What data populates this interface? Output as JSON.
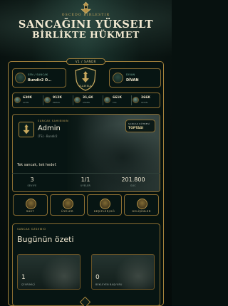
{
  "colors": {
    "gold": "#a8843c",
    "gold_text": "#c9a95e",
    "teal_label": "#7fb9a4",
    "background": "#07110f"
  },
  "header": {
    "subtitle": "OSCEDO BIRLESTIR",
    "title_line1": "SANCAĞINI YÜKSELT",
    "title_line2": "BİRLİKTE HÜKMET"
  },
  "top_bar": {
    "pill": "V1 / SANDR",
    "logo_text": "SAHBA",
    "sancak_label": "SEN / SANCAK",
    "sancak_value": "Bundir2 O…",
    "divan_label": "DIVAN",
    "divan_value": "DİVAN"
  },
  "stats": [
    {
      "value": "630K",
      "sub": "ALTIN",
      "icon": "coin-icon"
    },
    {
      "value": "912K",
      "sub": "ERZAK",
      "icon": "grain-icon"
    },
    {
      "value": "31,6K",
      "sub": "ASKER",
      "icon": "sword-icon"
    },
    {
      "value": "661K",
      "sub": "TAS",
      "icon": "stone-icon"
    },
    {
      "value": "266K",
      "sub": "ODUN",
      "icon": "wood-icon"
    }
  ],
  "profile": {
    "section_label": "SANCAK SAHIBININ",
    "name": "Admin",
    "subtitle": "(TS) · Bundir2",
    "tier_label": "SANCAK RÜTBESİ",
    "tier_value": "TOPTASI",
    "motto": "Tek sancak, tek hedef.",
    "stats": [
      {
        "value": "3",
        "label": "SEVIYE"
      },
      {
        "value": "1/1",
        "label": "UYELER"
      },
      {
        "value": "201.800",
        "label": "GUC"
      }
    ]
  },
  "actions": [
    {
      "label": "SAVT",
      "icon": "helmet-icon"
    },
    {
      "label": "ÜYELER",
      "icon": "members-icon"
    },
    {
      "label": "KEŞİFLER/GÖ",
      "icon": "compass-icon"
    },
    {
      "label": "GELİŞİMLER",
      "icon": "castle-icon"
    }
  ],
  "summary": {
    "section_label": "SANCAK OZSEWIO",
    "title": "Bugünün özeti",
    "cards": [
      {
        "value": "1",
        "label": "ÇEVRİMİÇİ"
      },
      {
        "value": "0",
        "label": "BEKLEYEN BAŞVURU"
      }
    ]
  }
}
